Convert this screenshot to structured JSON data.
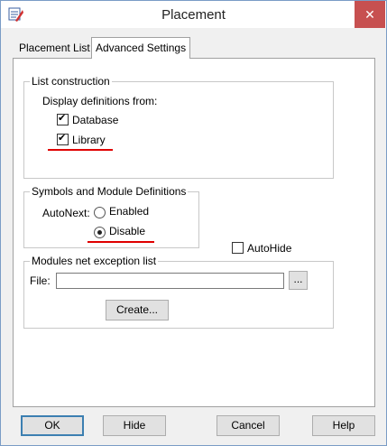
{
  "window": {
    "title": "Placement",
    "controls": {
      "minimize": "—",
      "maximize": "☐",
      "close": "✕"
    },
    "accent": "#c75050"
  },
  "tabs": [
    {
      "label": "Placement List",
      "active": false
    },
    {
      "label": "Advanced Settings",
      "active": true
    }
  ],
  "list_construction": {
    "group_label": "List construction",
    "display_label": "Display definitions from:",
    "database": {
      "label": "Database",
      "checked": true
    },
    "library": {
      "label": "Library",
      "checked": true
    }
  },
  "symbols": {
    "group_label": "Symbols and Module Definitions",
    "autonext_label": "AutoNext:",
    "enabled": {
      "label": "Enabled",
      "selected": false
    },
    "disable": {
      "label": "Disable",
      "selected": true
    }
  },
  "autohide": {
    "label": "AutoHide",
    "checked": false
  },
  "modules": {
    "group_label": "Modules net exception list",
    "file_label": "File:",
    "file_value": "",
    "browse_label": "...",
    "create_label": "Create..."
  },
  "buttons": {
    "ok": "OK",
    "hide": "Hide",
    "cancel": "Cancel",
    "help": "Help"
  },
  "annotation_color": "#e00000"
}
